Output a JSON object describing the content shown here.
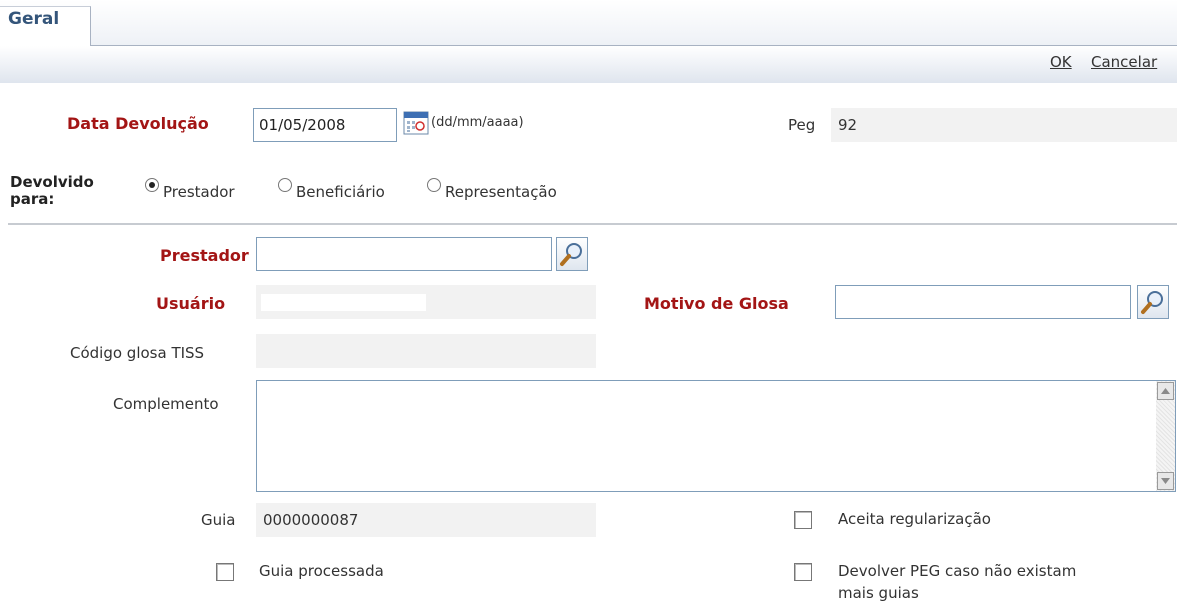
{
  "tabs": [
    {
      "label": "Geral"
    }
  ],
  "toolbar": {
    "ok_label": "OK",
    "cancel_label": "Cancelar"
  },
  "form": {
    "data_devolucao": {
      "label": "Data Devolução",
      "value": "01/05/2008",
      "format_hint": "(dd/mm/aaaa)"
    },
    "peg": {
      "label": "Peg",
      "value": "92"
    },
    "devolvido_para": {
      "label_line1": "Devolvido",
      "label_line2": "para:",
      "options": [
        {
          "label": "Prestador",
          "selected": true
        },
        {
          "label": "Beneficiário",
          "selected": false
        },
        {
          "label": "Representação",
          "selected": false
        }
      ]
    },
    "prestador": {
      "label": "Prestador",
      "value": ""
    },
    "usuario": {
      "label": "Usuário",
      "value": ""
    },
    "motivo_glosa": {
      "label": "Motivo de Glosa",
      "value": ""
    },
    "codigo_glosa_tiss": {
      "label": "Código glosa TISS",
      "value": ""
    },
    "complemento": {
      "label": "Complemento",
      "value": ""
    },
    "guia": {
      "label": "Guia",
      "value": "0000000087"
    },
    "aceita_regularizacao": {
      "label": "Aceita regularização",
      "checked": false
    },
    "guia_processada": {
      "label": "Guia processada",
      "checked": false
    },
    "devolver_peg": {
      "label_line1": "Devolver PEG caso não existam",
      "label_line2": "mais guias",
      "checked": false
    }
  },
  "colors": {
    "required_label": "#a31515",
    "tab_text": "#34557a",
    "input_border": "#7f9db9",
    "readonly_bg": "#f2f2f2"
  }
}
